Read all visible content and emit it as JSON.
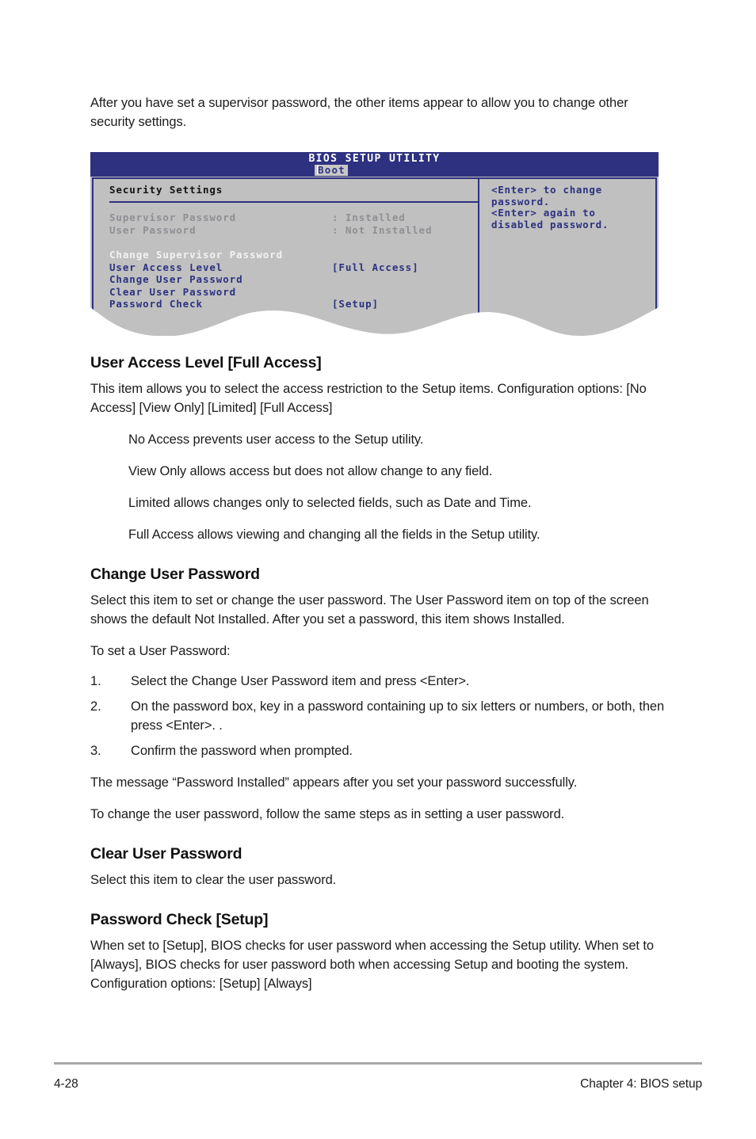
{
  "page": {
    "intro_paragraph": "After you have set a supervisor password, the other items appear to allow you to change other security settings.",
    "footer_page_number": "4-28",
    "footer_chapter": "Chapter 4: BIOS setup"
  },
  "bios_screen": {
    "title": "BIOS SETUP UTILITY",
    "active_tab": "Boot",
    "section_heading": "Security Settings",
    "status_rows": [
      {
        "label": "Supervisor Password",
        "value": ": Installed"
      },
      {
        "label": "User Password",
        "value": ": Not Installed"
      }
    ],
    "menu_rows": [
      {
        "label": "Change Supervisor Password",
        "value": ""
      },
      {
        "label": "User Access Level",
        "value": "[Full Access]"
      },
      {
        "label": "Change User Password",
        "value": ""
      },
      {
        "label": "Clear User Password",
        "value": ""
      },
      {
        "label": "Password Check",
        "value": "[Setup]"
      }
    ],
    "help_text": "<Enter> to change password.\n<Enter> again to disabled password.",
    "help_dash": "-",
    "colors": {
      "title_bar": "#2e3180",
      "panel_background": "#c0c0c0",
      "accent_blue": "#2e3180",
      "tab_highlight": "#c7c7c7",
      "disabled_gray": "#8f8f94",
      "selected_white": "#f2f2f2"
    }
  },
  "sections": [
    {
      "heading": "User Access Level [Full Access]",
      "paragraphs": [
        "This item allows you to select the access restriction to the Setup items. Configuration options: [No Access] [View Only] [Limited] [Full Access]"
      ],
      "indented_lines": [
        "No Access prevents user access to the Setup utility.",
        "View Only allows access but does not allow change to any field.",
        "Limited allows changes only to selected fields, such as Date and Time.",
        "Full Access allows viewing and changing all the fields in the Setup utility."
      ]
    },
    {
      "heading": "Change User Password",
      "paragraphs": [
        "Select this item to set or change the user password. The User Password item on top of the screen shows the default Not Installed. After you set a password, this item shows Installed.",
        "To set a User Password:"
      ],
      "steps": [
        {
          "num": "1.",
          "text": "Select the Change User Password item and press <Enter>."
        },
        {
          "num": "2.",
          "text": "On the password box, key in a password containing up to six letters or numbers, or both, then press <Enter>. ."
        },
        {
          "num": "3.",
          "text": "Confirm the password when prompted."
        }
      ],
      "after_paragraphs": [
        "The message “Password Installed” appears after you set your password successfully.",
        "To change the user password, follow the same steps as in setting a user password."
      ]
    },
    {
      "heading": "Clear User Password",
      "paragraphs": [
        "Select this item to clear the user password."
      ]
    },
    {
      "heading": "Password Check [Setup]",
      "paragraphs": [
        "When set to [Setup], BIOS checks for user password when accessing the Setup utility. When set to [Always], BIOS checks for user password both when accessing Setup and booting the system. Configuration options: [Setup] [Always]"
      ]
    }
  ]
}
